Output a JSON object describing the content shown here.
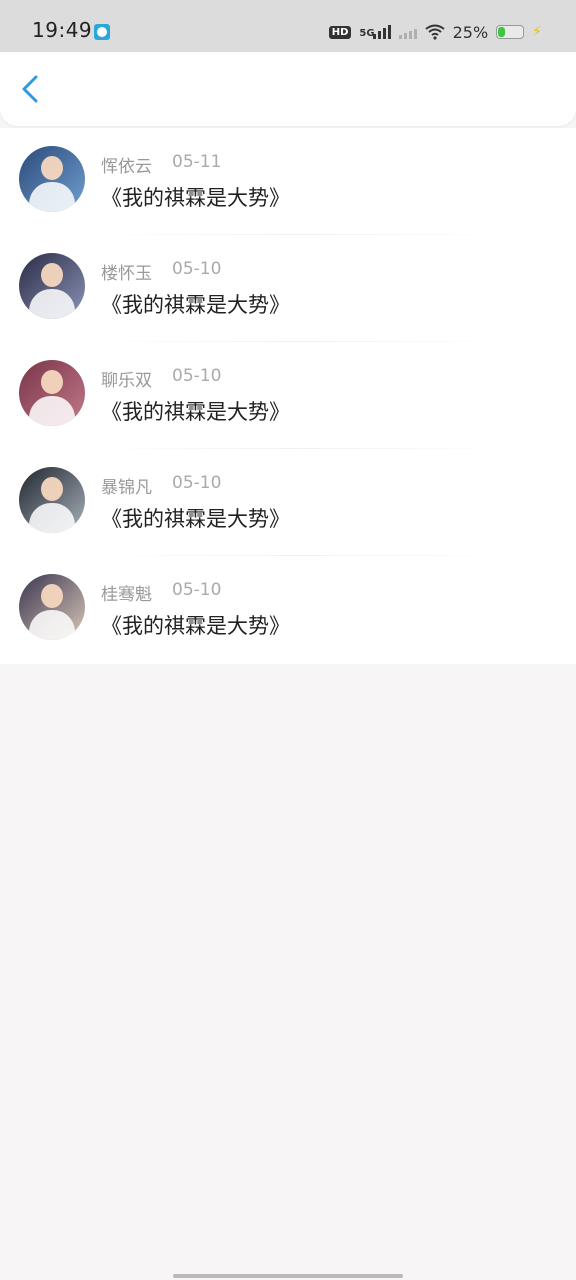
{
  "status_bar": {
    "time": "19:49",
    "hd": "HD",
    "network": "5G",
    "battery_percent": "25%",
    "battery_level": 0.25,
    "icons": [
      "app-notification-icon",
      "hd-icon",
      "signal-5g-icon",
      "signal-icon",
      "wifi-icon",
      "battery-icon",
      "charging-icon"
    ]
  },
  "header": {
    "back_icon": "chevron-left-icon",
    "accent_color": "#2d9ae0"
  },
  "list": {
    "items": [
      {
        "name": "恽依云",
        "date": "05-11",
        "title": "《我的祺霖是大势》",
        "avatar_colors": [
          "#2c4a7a",
          "#6fa0d0"
        ]
      },
      {
        "name": "楼怀玉",
        "date": "05-10",
        "title": "《我的祺霖是大势》",
        "avatar_colors": [
          "#2b2b45",
          "#8a94b8"
        ]
      },
      {
        "name": "聊乐双",
        "date": "05-10",
        "title": "《我的祺霖是大势》",
        "avatar_colors": [
          "#7a3448",
          "#c07a88"
        ]
      },
      {
        "name": "暴锦凡",
        "date": "05-10",
        "title": "《我的祺霖是大势》",
        "avatar_colors": [
          "#1f2630",
          "#a8b0ba"
        ]
      },
      {
        "name": "桂骞魁",
        "date": "05-10",
        "title": "《我的祺霖是大势》",
        "avatar_colors": [
          "#3b3550",
          "#d8c8b8"
        ]
      }
    ]
  }
}
